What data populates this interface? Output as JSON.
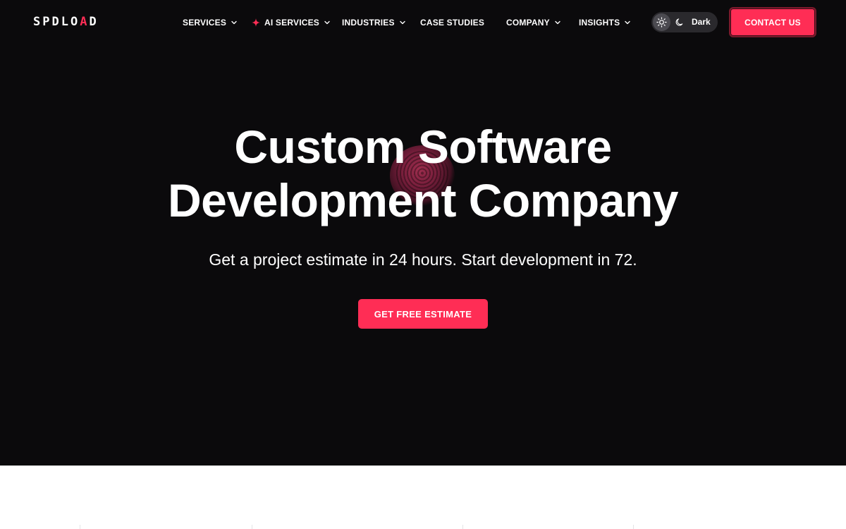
{
  "header": {
    "logo": {
      "prefix": "SPDLO",
      "accent": "A",
      "suffix": "D"
    },
    "nav": [
      {
        "label": "SERVICES",
        "has_dropdown": true,
        "icon": "chevron-down-icon"
      },
      {
        "label": "AI SERVICES",
        "has_dropdown": true,
        "icon": "sparkle-icon"
      },
      {
        "label": "INDUSTRIES",
        "has_dropdown": true,
        "icon": "chevron-down-icon"
      },
      {
        "label": "CASE STUDIES",
        "has_dropdown": false
      },
      {
        "label": "COMPANY",
        "has_dropdown": true,
        "icon": "chevron-down-icon"
      },
      {
        "label": "INSIGHTS",
        "has_dropdown": true,
        "icon": "chevron-down-icon"
      }
    ],
    "theme_toggle": {
      "label": "Dark",
      "icons": [
        "sun-icon",
        "moon-icon"
      ]
    },
    "contact_label": "CONTACT US"
  },
  "hero": {
    "title_line1": "Custom Software",
    "title_line2": "Development Company",
    "subtitle": "Get a project estimate in 24 hours. Start development in 72.",
    "cta_label": "GET FREE ESTIMATE"
  },
  "colors": {
    "background": "#0b0a0c",
    "accent": "#ff2d55",
    "text": "#ffffff",
    "toggle_bg": "#2a292d",
    "section_bg": "#ffffff"
  }
}
